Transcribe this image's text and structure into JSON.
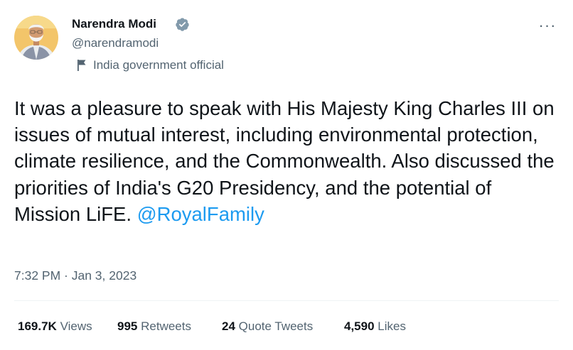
{
  "author": {
    "display_name": "Narendra Modi",
    "handle": "@narendramodi",
    "verified": true,
    "verified_icon": "verified-badge-icon",
    "affiliation": "India government official",
    "affiliation_icon": "flag-icon"
  },
  "more_menu": {
    "label": "···",
    "icon": "more-options-icon"
  },
  "tweet": {
    "text": "It was a pleasure to speak with His Majesty King Charles III on issues of mutual interest, including environmental protection, climate resilience, and the Commonwealth. Also discussed the priorities of India's G20 Presidency, and the potential of Mission LiFE.",
    "mention": "@RoyalFamily",
    "timestamp": "7:32 PM · Jan 3, 2023"
  },
  "stats": [
    {
      "count": "169.7K",
      "label": "Views"
    },
    {
      "count": "995",
      "label": "Retweets"
    },
    {
      "count": "24",
      "label": "Quote Tweets"
    },
    {
      "count": "4,590",
      "label": "Likes"
    }
  ],
  "colors": {
    "text_primary": "#0f1419",
    "text_secondary": "#536471",
    "link": "#1d9bf0",
    "verified": "#829aab",
    "divider": "#eff3f4"
  }
}
